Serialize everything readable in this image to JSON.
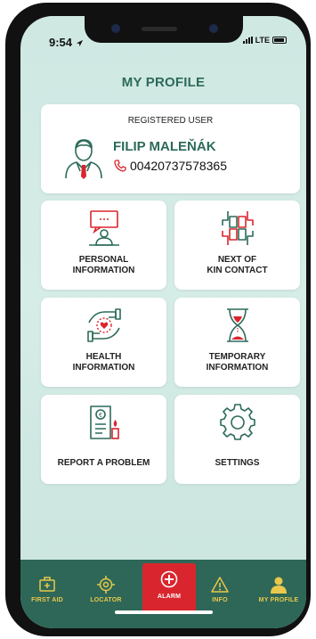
{
  "status_bar": {
    "time": "9:54",
    "network": "LTE"
  },
  "header": {
    "title": "MY PROFILE"
  },
  "user": {
    "caption": "REGISTERED USER",
    "name": "FILIP MALEŇÁK",
    "phone": "00420737578365"
  },
  "tiles": [
    {
      "line1": "PERSONAL",
      "line2": "INFORMATION",
      "icon": "presenter-icon"
    },
    {
      "line1": "NEXT OF",
      "line2": "KIN CONTACT",
      "icon": "hands-circle-icon"
    },
    {
      "line1": "HEALTH",
      "line2": "INFORMATION",
      "icon": "heart-hands-icon"
    },
    {
      "line1": "TEMPORARY",
      "line2": "INFORMATION",
      "icon": "hourglass-icon"
    },
    {
      "line1": "REPORT A PROBLEM",
      "icon": "document-candle-icon"
    },
    {
      "line1": "SETTINGS",
      "icon": "gear-icon"
    }
  ],
  "tabbar": {
    "items": [
      {
        "label": "FIRST AID",
        "icon": "first-aid-kit-icon"
      },
      {
        "label": "LOCATOR",
        "icon": "crosshair-icon"
      },
      {
        "label": "ALARM",
        "icon": "alarm-plus-icon"
      },
      {
        "label": "INFO",
        "icon": "warning-triangle-icon"
      },
      {
        "label": "MY PROFILE",
        "icon": "person-icon"
      }
    ],
    "active": "ALARM"
  },
  "colors": {
    "brand_green": "#2c6a5a",
    "tab_bg": "#2e6757",
    "tab_label": "#e9c84c",
    "alarm_red": "#d9262e",
    "accent_red": "#d9262e"
  }
}
